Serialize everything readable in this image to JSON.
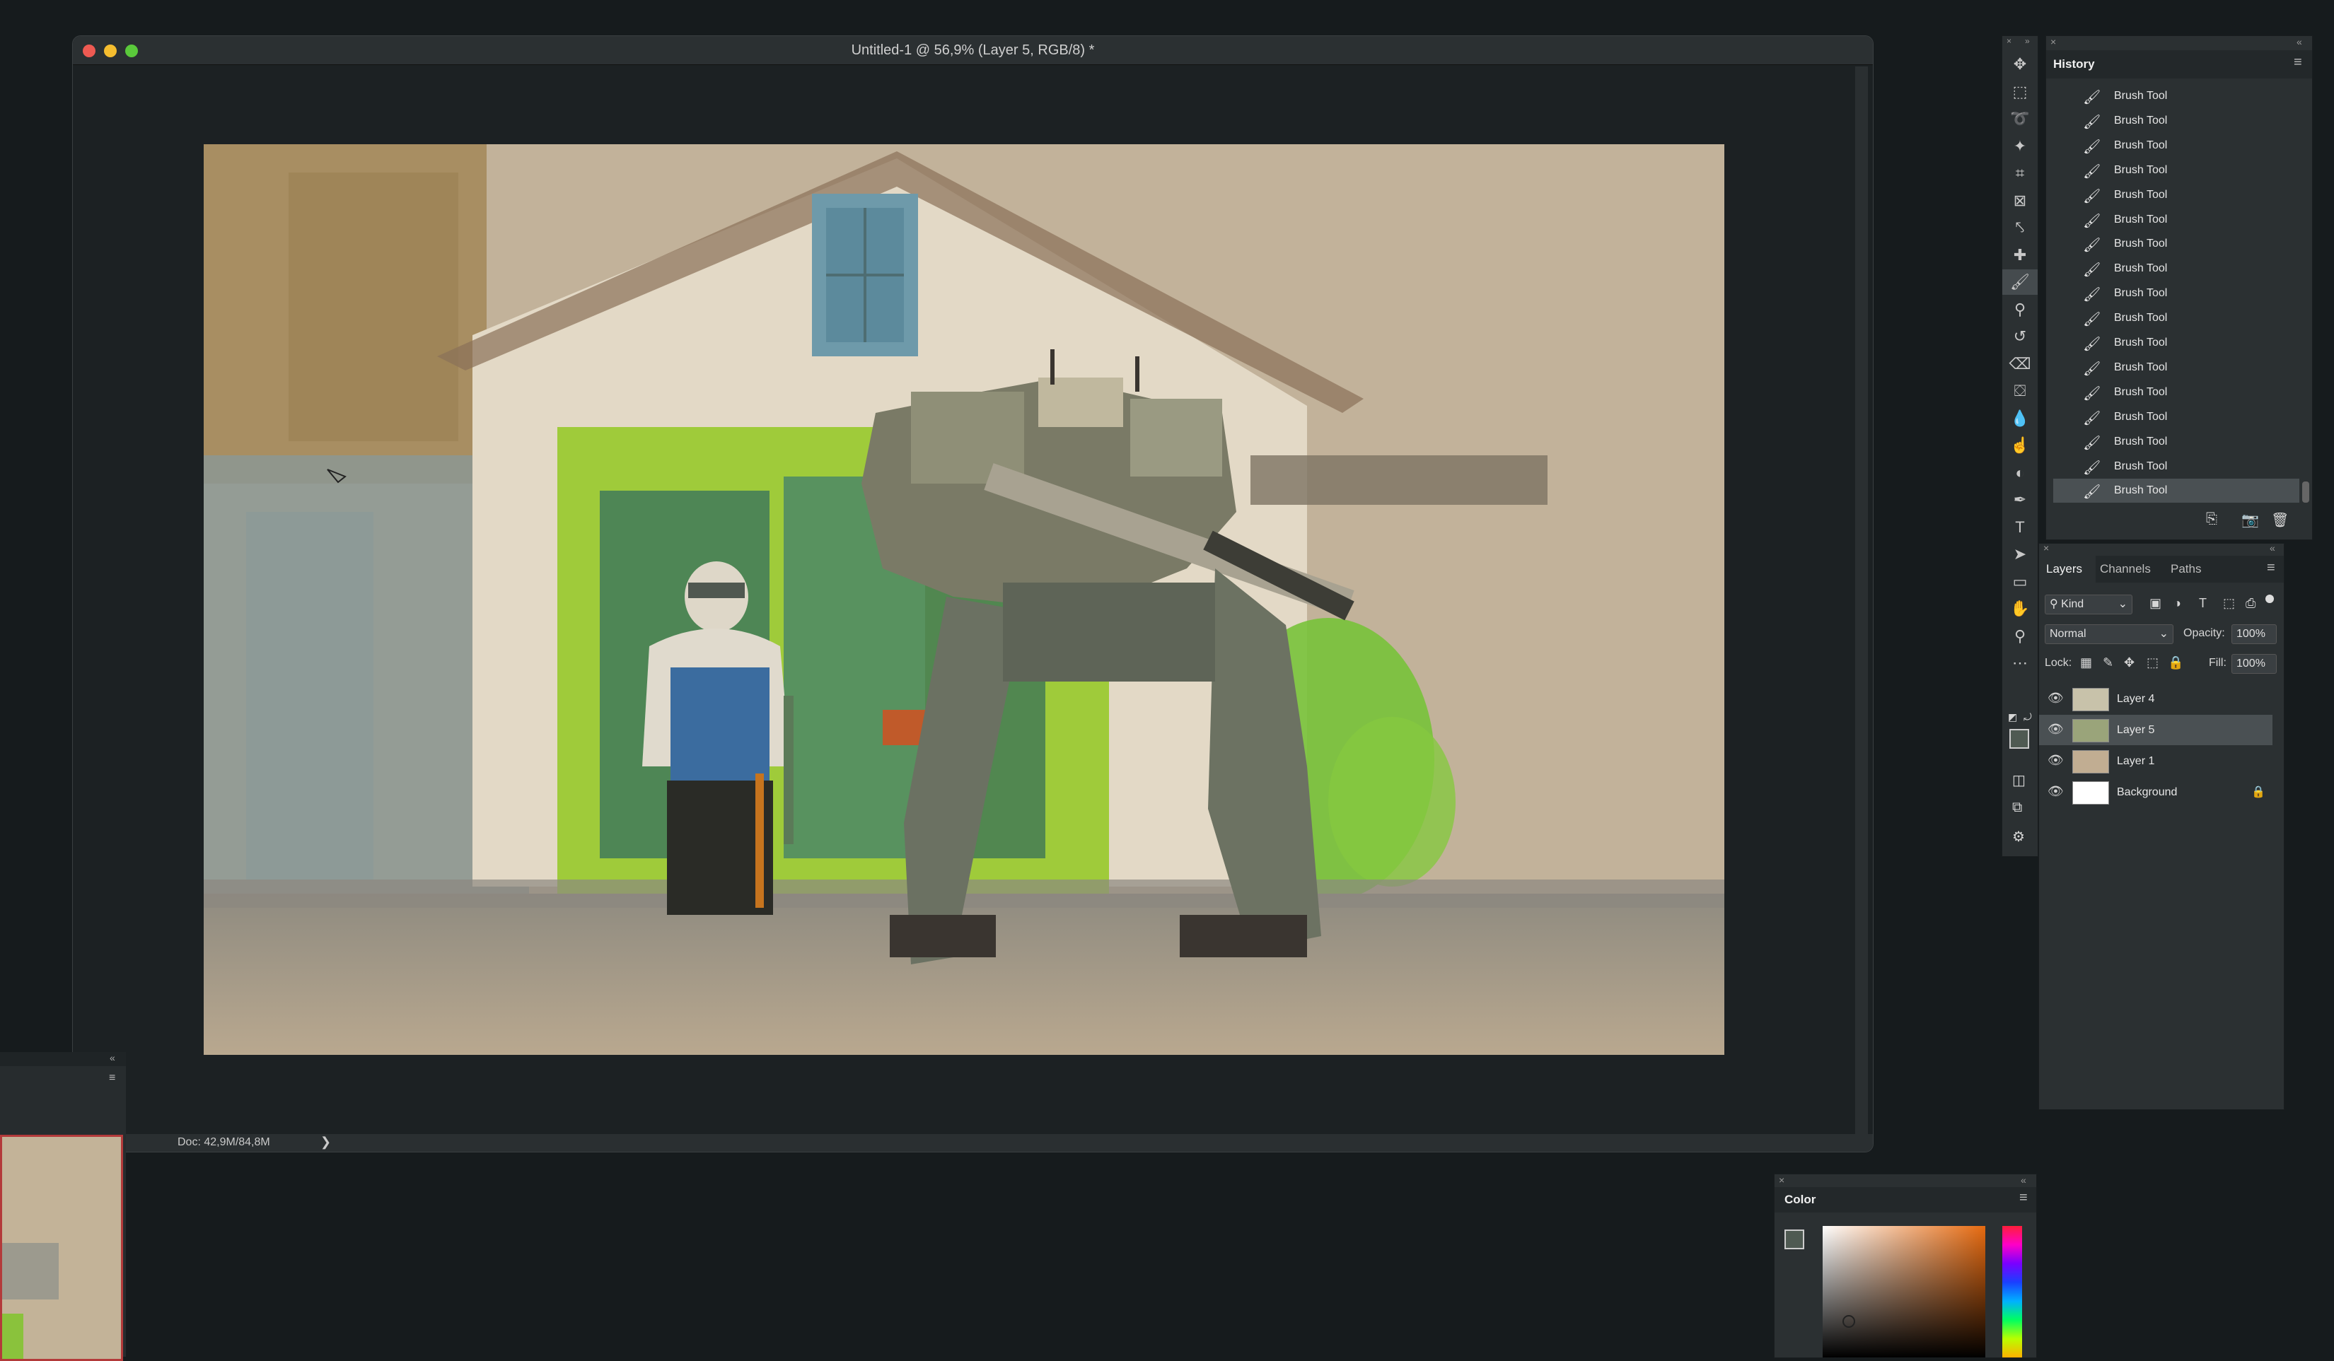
{
  "document": {
    "title": "Untitled-1 @ 56,9% (Layer 5, RGB/8) *",
    "status": "Doc: 42,9M/84,8M",
    "status_arrow": "❯",
    "traffic_lights": [
      "#ee5a52",
      "#f5bd2f",
      "#5ac93b"
    ]
  },
  "toolbar": {
    "tools": [
      {
        "name": "move-tool",
        "glyph": "✥"
      },
      {
        "name": "marquee-tool",
        "glyph": "⬚"
      },
      {
        "name": "lasso-tool",
        "glyph": "➰"
      },
      {
        "name": "magic-wand-tool",
        "glyph": "✦"
      },
      {
        "name": "crop-tool",
        "glyph": "⌗"
      },
      {
        "name": "frame-tool",
        "glyph": "⊠"
      },
      {
        "name": "eyedropper-tool",
        "glyph": "⤣"
      },
      {
        "name": "healing-brush-tool",
        "glyph": "✚"
      },
      {
        "name": "brush-tool",
        "glyph": "🖌",
        "active": true
      },
      {
        "name": "clone-stamp-tool",
        "glyph": "⚲"
      },
      {
        "name": "history-brush-tool",
        "glyph": "↺"
      },
      {
        "name": "eraser-tool",
        "glyph": "⌫"
      },
      {
        "name": "paint-bucket-tool",
        "glyph": "⛋"
      },
      {
        "name": "blur-tool",
        "glyph": "💧"
      },
      {
        "name": "smudge-tool",
        "glyph": "☝"
      },
      {
        "name": "dodge-tool",
        "glyph": "◐"
      },
      {
        "name": "pen-tool",
        "glyph": "✒"
      },
      {
        "name": "type-tool",
        "glyph": "T"
      },
      {
        "name": "path-selection-tool",
        "glyph": "➤"
      },
      {
        "name": "rectangle-tool",
        "glyph": "▭"
      },
      {
        "name": "hand-tool",
        "glyph": "✋"
      },
      {
        "name": "zoom-tool",
        "glyph": "⚲"
      },
      {
        "name": "more-tools",
        "glyph": "⋯"
      }
    ],
    "foreground_color": "#4f5a52",
    "background_color": "#3a8fe0"
  },
  "history": {
    "title": "History",
    "menu_glyph": "≡",
    "items": [
      "Brush Tool",
      "Brush Tool",
      "Brush Tool",
      "Brush Tool",
      "Brush Tool",
      "Brush Tool",
      "Brush Tool",
      "Brush Tool",
      "Brush Tool",
      "Brush Tool",
      "Brush Tool",
      "Brush Tool",
      "Brush Tool",
      "Brush Tool",
      "Brush Tool",
      "Brush Tool",
      "Brush Tool"
    ],
    "current_index": 16
  },
  "layers": {
    "tabs": [
      "Layers",
      "Channels",
      "Paths"
    ],
    "active_tab": 0,
    "filter_kind": "Kind",
    "blend_mode": "Normal",
    "opacity_label": "Opacity:",
    "opacity_value": "100%",
    "lock_label": "Lock:",
    "fill_label": "Fill:",
    "fill_value": "100%",
    "items": [
      {
        "name": "Layer 4",
        "thumb": "#c8c2aa",
        "active": false,
        "locked": false
      },
      {
        "name": "Layer 5",
        "thumb": "#9aa47a",
        "active": true,
        "locked": false
      },
      {
        "name": "Layer 1",
        "thumb": "#c1ad92",
        "active": false,
        "locked": false
      },
      {
        "name": "Background",
        "thumb": "#ffffff",
        "active": false,
        "locked": true
      }
    ]
  },
  "color_panel": {
    "title": "Color",
    "menu_glyph": "≡"
  }
}
